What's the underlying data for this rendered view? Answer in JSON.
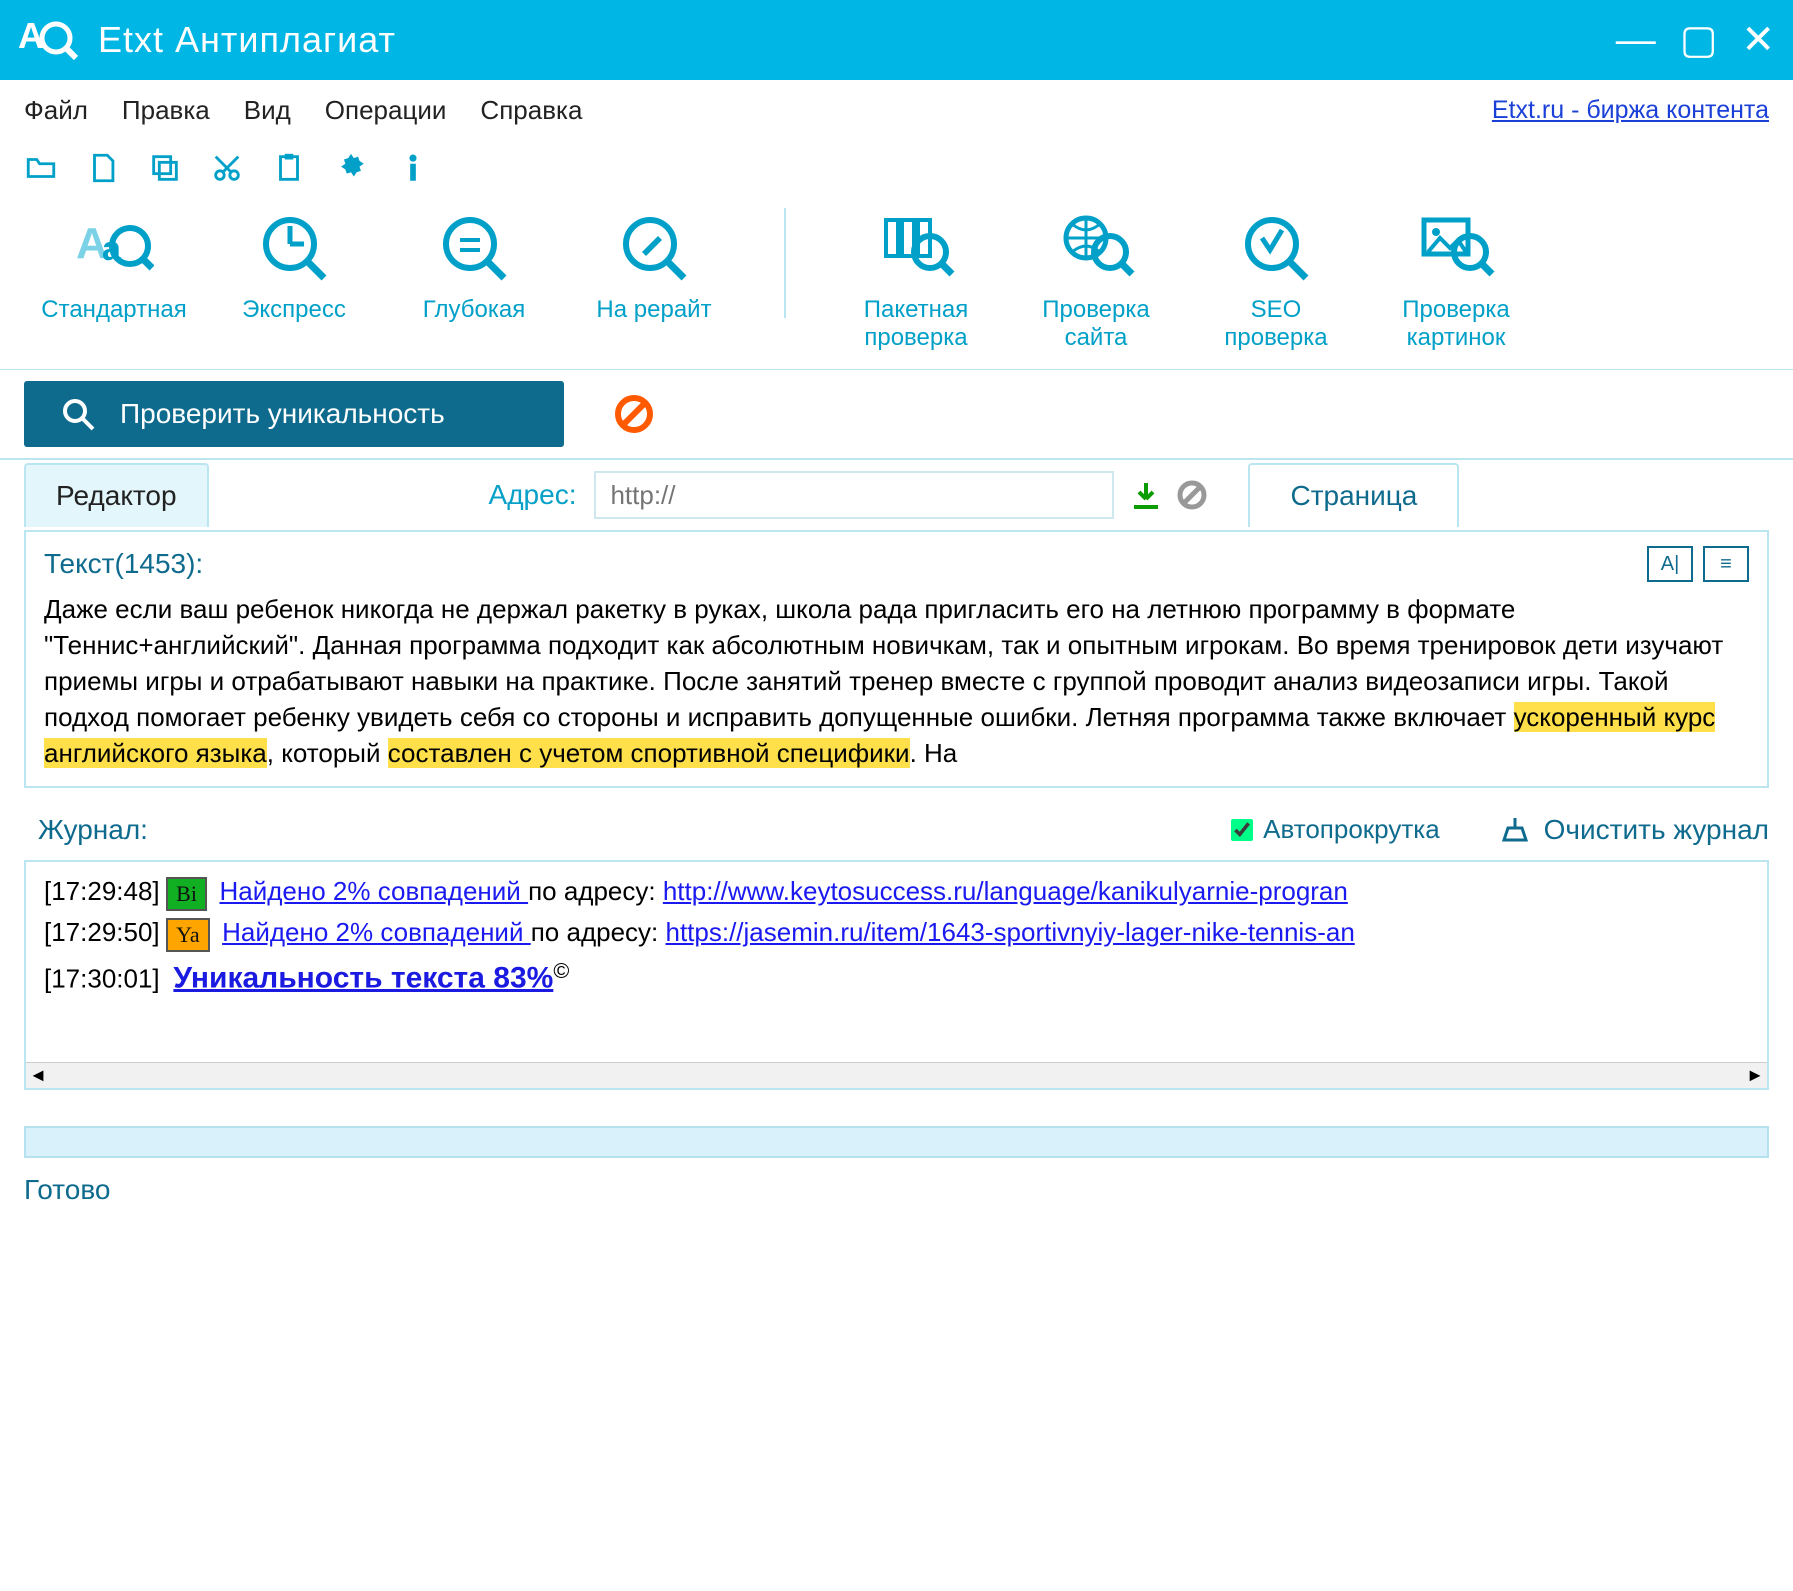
{
  "window": {
    "title": "Etxt Антиплагиат"
  },
  "menu": {
    "items": [
      "Файл",
      "Правка",
      "Вид",
      "Операции",
      "Справка"
    ],
    "right_link": "Etxt.ru - биржа контента"
  },
  "big_actions_left": [
    {
      "id": "standard",
      "label": "Стандартная"
    },
    {
      "id": "express",
      "label": "Экспресс"
    },
    {
      "id": "deep",
      "label": "Глубокая"
    },
    {
      "id": "rewrite",
      "label": "На рерайт"
    }
  ],
  "big_actions_right": [
    {
      "id": "batch",
      "label": "Пакетная\nпроверка"
    },
    {
      "id": "site",
      "label": "Проверка\nсайта"
    },
    {
      "id": "seo",
      "label": "SEO\nпроверка"
    },
    {
      "id": "images",
      "label": "Проверка\nкартинок"
    }
  ],
  "check_button": "Проверить уникальность",
  "tabs": {
    "editor": "Редактор",
    "page": "Страница"
  },
  "address": {
    "label": "Адрес:",
    "placeholder": "http://"
  },
  "editor_title": "Текст(1453):",
  "editor_text": {
    "p1": "Даже если ваш ребенок никогда не держал ракетку в руках, школа рада пригласить его на летнюю программу в формате \"Теннис+английский\". Данная программа подходит как абсолютным новичкам, так и опытным игрокам. Во время тренировок дети изучают приемы игры и отрабатывают навыки на практике. После занятий тренер вместе с группой проводит анализ видеозаписи игры. Такой подход помогает ребенку увидеть себя со стороны и исправить допущенные ошибки. Летняя программа также включает ",
    "h1": "ускоренный курс английского языка",
    "p2": ", который ",
    "h2": "составлен с учетом спортивной специфики",
    "p3": ". На"
  },
  "log_head": {
    "title": "Журнал:",
    "autoscroll": "Автопрокрутка",
    "clear": "Очистить журнал"
  },
  "log": [
    {
      "time": "[17:29:48]",
      "src": "Bi",
      "found": "Найдено 2% совпадений ",
      "mid": "по адресу: ",
      "url": "http://www.keytosuccess.ru/language/kanikulyarnie-progran"
    },
    {
      "time": "[17:29:50]",
      "src": "Ya",
      "found": "Найдено 2% совпадений ",
      "mid": "по адресу: ",
      "url": "https://jasemin.ru/item/1643-sportivnyiy-lager-nike-tennis-an"
    }
  ],
  "result": {
    "time": "[17:30:01]",
    "text": "Уникальность текста 83%",
    "sup": "©"
  },
  "status": "Готово"
}
